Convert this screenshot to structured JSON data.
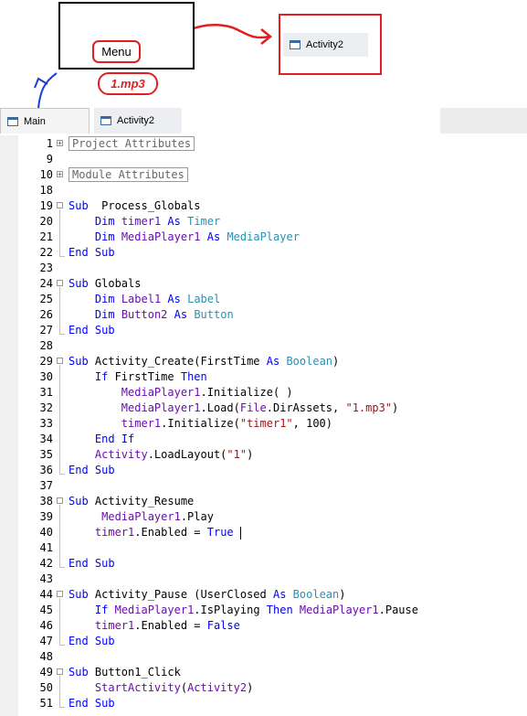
{
  "annotations": {
    "menu_button_label": "Menu",
    "mp3_note": "1.mp3",
    "activity_tab_label": "Activity2",
    "colors": {
      "red": "#e02020",
      "blue": "#1a3fd8"
    }
  },
  "tabs": [
    {
      "label": "Main",
      "active": true
    },
    {
      "label": "Activity2",
      "active": false
    }
  ],
  "code_lines": [
    {
      "n": "1",
      "fold": "+",
      "region": "Project Attributes"
    },
    {
      "n": "9"
    },
    {
      "n": "10",
      "fold": "+",
      "region": "Module Attributes"
    },
    {
      "n": "18"
    },
    {
      "n": "19",
      "fold": "-",
      "tokens": [
        [
          "kw",
          "Sub"
        ],
        [
          "",
          "  Process_Globals"
        ]
      ]
    },
    {
      "n": "20",
      "tokens": [
        [
          "",
          "    "
        ],
        [
          "kw",
          "Dim"
        ],
        [
          "",
          " "
        ],
        [
          "obj",
          "timer1"
        ],
        [
          "",
          " "
        ],
        [
          "kw",
          "As"
        ],
        [
          "",
          " "
        ],
        [
          "ty",
          "Timer"
        ]
      ]
    },
    {
      "n": "21",
      "tokens": [
        [
          "",
          "    "
        ],
        [
          "kw",
          "Dim"
        ],
        [
          "",
          " "
        ],
        [
          "obj",
          "MediaPlayer1"
        ],
        [
          "",
          " "
        ],
        [
          "kw",
          "As"
        ],
        [
          "",
          " "
        ],
        [
          "ty",
          "MediaPlayer"
        ]
      ]
    },
    {
      "n": "22",
      "tokens": [
        [
          "kw",
          "End Sub"
        ]
      ]
    },
    {
      "n": "23"
    },
    {
      "n": "24",
      "fold": "-",
      "tokens": [
        [
          "kw",
          "Sub"
        ],
        [
          "",
          " Globals"
        ]
      ]
    },
    {
      "n": "25",
      "tokens": [
        [
          "",
          "    "
        ],
        [
          "kw",
          "Dim"
        ],
        [
          "",
          " "
        ],
        [
          "obj",
          "Label1"
        ],
        [
          "",
          " "
        ],
        [
          "kw",
          "As"
        ],
        [
          "",
          " "
        ],
        [
          "ty",
          "Label"
        ]
      ]
    },
    {
      "n": "26",
      "tokens": [
        [
          "",
          "    "
        ],
        [
          "kw",
          "Dim"
        ],
        [
          "",
          " "
        ],
        [
          "obj",
          "Button2"
        ],
        [
          "",
          " "
        ],
        [
          "kw",
          "As"
        ],
        [
          "",
          " "
        ],
        [
          "ty",
          "Button"
        ]
      ]
    },
    {
      "n": "27",
      "tokens": [
        [
          "kw",
          "End Sub"
        ]
      ]
    },
    {
      "n": "28"
    },
    {
      "n": "29",
      "fold": "-",
      "tokens": [
        [
          "kw",
          "Sub"
        ],
        [
          "",
          " Activity_Create(FirstTime "
        ],
        [
          "kw",
          "As"
        ],
        [
          "",
          " "
        ],
        [
          "ty",
          "Boolean"
        ],
        [
          "",
          ")"
        ]
      ]
    },
    {
      "n": "30",
      "tokens": [
        [
          "",
          "    "
        ],
        [
          "kw",
          "If"
        ],
        [
          "",
          " FirstTime "
        ],
        [
          "kw",
          "Then"
        ]
      ]
    },
    {
      "n": "31",
      "tokens": [
        [
          "",
          "        "
        ],
        [
          "obj",
          "MediaPlayer1"
        ],
        [
          "",
          ".Initialize( )"
        ]
      ]
    },
    {
      "n": "32",
      "tokens": [
        [
          "",
          "        "
        ],
        [
          "obj",
          "MediaPlayer1"
        ],
        [
          "",
          ".Load("
        ],
        [
          "obj",
          "File"
        ],
        [
          "",
          ".DirAssets, "
        ],
        [
          "str",
          "\"1.mp3\""
        ],
        [
          "",
          ")"
        ]
      ]
    },
    {
      "n": "33",
      "tokens": [
        [
          "",
          "        "
        ],
        [
          "obj",
          "timer1"
        ],
        [
          "",
          ".Initialize("
        ],
        [
          "str",
          "\"timer1\""
        ],
        [
          "",
          ", 100)"
        ]
      ]
    },
    {
      "n": "34",
      "tokens": [
        [
          "",
          "    "
        ],
        [
          "kw",
          "End If"
        ]
      ]
    },
    {
      "n": "35",
      "tokens": [
        [
          "",
          "    "
        ],
        [
          "obj",
          "Activity"
        ],
        [
          "",
          ".LoadLayout("
        ],
        [
          "str",
          "\"1\""
        ],
        [
          "",
          ")"
        ]
      ]
    },
    {
      "n": "36",
      "tokens": [
        [
          "kw",
          "End Sub"
        ]
      ]
    },
    {
      "n": "37"
    },
    {
      "n": "38",
      "fold": "-",
      "tokens": [
        [
          "kw",
          "Sub"
        ],
        [
          "",
          " Activity_Resume"
        ]
      ]
    },
    {
      "n": "39",
      "tokens": [
        [
          "",
          "     "
        ],
        [
          "obj",
          "MediaPlayer1"
        ],
        [
          "",
          ".Play"
        ]
      ]
    },
    {
      "n": "40",
      "tokens": [
        [
          "",
          "    "
        ],
        [
          "obj",
          "timer1"
        ],
        [
          "",
          ".Enabled = "
        ],
        [
          "kw",
          "True"
        ],
        [
          "",
          " "
        ]
      ],
      "caret": true
    },
    {
      "n": "41"
    },
    {
      "n": "42",
      "tokens": [
        [
          "kw",
          "End Sub"
        ]
      ]
    },
    {
      "n": "43"
    },
    {
      "n": "44",
      "fold": "-",
      "tokens": [
        [
          "kw",
          "Sub"
        ],
        [
          "",
          " Activity_Pause (UserClosed "
        ],
        [
          "kw",
          "As"
        ],
        [
          "",
          " "
        ],
        [
          "ty",
          "Boolean"
        ],
        [
          "",
          ")"
        ]
      ]
    },
    {
      "n": "45",
      "tokens": [
        [
          "",
          "    "
        ],
        [
          "kw",
          "If"
        ],
        [
          "",
          " "
        ],
        [
          "obj",
          "MediaPlayer1"
        ],
        [
          "",
          ".IsPlaying "
        ],
        [
          "kw",
          "Then"
        ],
        [
          "",
          " "
        ],
        [
          "obj",
          "MediaPlayer1"
        ],
        [
          "",
          ".Pause"
        ]
      ]
    },
    {
      "n": "46",
      "tokens": [
        [
          "",
          "    "
        ],
        [
          "obj",
          "timer1"
        ],
        [
          "",
          ".Enabled = "
        ],
        [
          "kw",
          "False"
        ]
      ]
    },
    {
      "n": "47",
      "tokens": [
        [
          "kw",
          "End Sub"
        ]
      ]
    },
    {
      "n": "48"
    },
    {
      "n": "49",
      "fold": "-",
      "tokens": [
        [
          "kw",
          "Sub"
        ],
        [
          "",
          " Button1_Click"
        ]
      ]
    },
    {
      "n": "50",
      "tokens": [
        [
          "",
          "    "
        ],
        [
          "obj",
          "StartActivity"
        ],
        [
          "",
          "("
        ],
        [
          "obj",
          "Activity2"
        ],
        [
          "",
          ")"
        ]
      ]
    },
    {
      "n": "51",
      "tokens": [
        [
          "kw",
          "End Sub"
        ]
      ]
    }
  ]
}
